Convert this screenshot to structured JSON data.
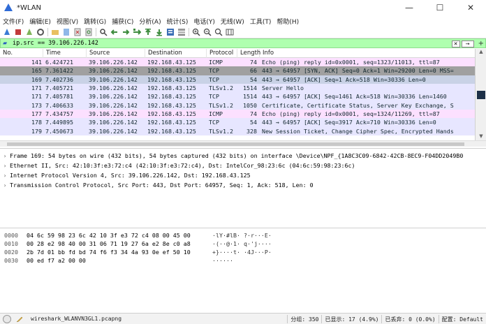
{
  "window": {
    "title": "*WLAN",
    "minimize_glyph": "—",
    "maximize_glyph": "☐",
    "close_glyph": "✕"
  },
  "menu": [
    "文件(F)",
    "编辑(E)",
    "视图(V)",
    "跳转(G)",
    "捕获(C)",
    "分析(A)",
    "统计(S)",
    "电话(Y)",
    "无线(W)",
    "工具(T)",
    "帮助(H)"
  ],
  "toolbar_icons": [
    "shark-fin-start-icon",
    "stop-capture-icon",
    "restart-capture-icon",
    "capture-options-icon",
    "open-file-icon",
    "save-file-icon",
    "close-file-icon",
    "reload-file-icon",
    "find-packet-icon",
    "go-back-icon",
    "go-forward-icon",
    "go-to-packet-icon",
    "go-first-icon",
    "go-last-icon",
    "autoscroll-icon",
    "colorize-icon",
    "zoom-in-icon",
    "zoom-out-icon",
    "zoom-normal-icon",
    "resize-columns-icon"
  ],
  "filter": {
    "text": "ip.src == 39.106.226.142",
    "clear_glyph": "✕",
    "apply_glyph": "→",
    "add_glyph": "+"
  },
  "packet_list": {
    "columns": [
      "No.",
      "Time",
      "Source",
      "Destination",
      "Protocol",
      "Length",
      "Info"
    ],
    "rows": [
      {
        "no": "141",
        "time": "6.424721",
        "src": "39.106.226.142",
        "dst": "192.168.43.125",
        "proto": "ICMP",
        "len": "74",
        "info": "Echo (ping) reply    id=0x0001, seq=1323/11013, ttl=87",
        "bg": "#fce0ff",
        "fg": "#12272e"
      },
      {
        "no": "165",
        "time": "7.361422",
        "src": "39.106.226.142",
        "dst": "192.168.43.125",
        "proto": "TCP",
        "len": "66",
        "info": "443 → 64957 [SYN, ACK] Seq=0 Ack=1 Win=29200 Len=0 MSS=",
        "bg": "#a0a0a0",
        "fg": "#12272e"
      },
      {
        "no": "169",
        "time": "7.402736",
        "src": "39.106.226.142",
        "dst": "192.168.43.125",
        "proto": "TCP",
        "len": "54",
        "info": "443 → 64957 [ACK] Seq=1 Ack=518 Win=30336 Len=0",
        "bg": "#c9d2e6",
        "fg": "#12272e"
      },
      {
        "no": "171",
        "time": "7.405721",
        "src": "39.106.226.142",
        "dst": "192.168.43.125",
        "proto": "TLSv1.2",
        "len": "1514",
        "info": "Server Hello",
        "bg": "#e7e6ff",
        "fg": "#12272e"
      },
      {
        "no": "171",
        "time": "7.405781",
        "src": "39.106.226.142",
        "dst": "192.168.43.125",
        "proto": "TCP",
        "len": "1514",
        "info": "443 → 64957 [ACK] Seq=1461 Ack=518 Win=30336 Len=1460",
        "bg": "#e7e6ff",
        "fg": "#12272e"
      },
      {
        "no": "173",
        "time": "7.406633",
        "src": "39.106.226.142",
        "dst": "192.168.43.125",
        "proto": "TLSv1.2",
        "len": "1050",
        "info": "Certificate, Certificate Status, Server Key Exchange, S",
        "bg": "#e7e6ff",
        "fg": "#12272e"
      },
      {
        "no": "177",
        "time": "7.434757",
        "src": "39.106.226.142",
        "dst": "192.168.43.125",
        "proto": "ICMP",
        "len": "74",
        "info": "Echo (ping) reply    id=0x0001, seq=1324/11269, ttl=87",
        "bg": "#fce0ff",
        "fg": "#12272e"
      },
      {
        "no": "178",
        "time": "7.449895",
        "src": "39.106.226.142",
        "dst": "192.168.43.125",
        "proto": "TCP",
        "len": "54",
        "info": "443 → 64957 [ACK] Seq=3917 Ack=710 Win=30336 Len=0",
        "bg": "#e7e6ff",
        "fg": "#12272e"
      },
      {
        "no": "179",
        "time": "7.450673",
        "src": "39.106.226.142",
        "dst": "192.168.43.125",
        "proto": "TLSv1.2",
        "len": "328",
        "info": "New Session Ticket, Change Cipher Spec, Encrypted Hands",
        "bg": "#e7e6ff",
        "fg": "#12272e"
      }
    ]
  },
  "details": [
    "Frame 169: 54 bytes on wire (432 bits), 54 bytes captured (432 bits) on interface \\Device\\NPF_{1A8C3C09-6842-42CB-8EC9-F04DD2049B0",
    "Ethernet II, Src: 42:10:3f:e3:72:c4 (42:10:3f:e3:72:c4), Dst: IntelCor_98:23:6c (04:6c:59:98:23:6c)",
    "Internet Protocol Version 4, Src: 39.106.226.142, Dst: 192.168.43.125",
    "Transmission Control Protocol, Src Port: 443, Dst Port: 64957, Seq: 1, Ack: 518, Len: 0"
  ],
  "details_arrow": "›",
  "bytes": [
    {
      "off": "0000",
      "hex": "04 6c 59 98 23 6c 42 10  3f e3 72 c4 08 00 45 00",
      "ascii": "·lY·#lB· ?·r···E·"
    },
    {
      "off": "0010",
      "hex": "00 28 e2 98 40 00 31 06  71 19 27 6a e2 8e c0 a8",
      "ascii": "·(··@·1· q·'j····"
    },
    {
      "off": "0020",
      "hex": "2b 7d 01 bb fd bd 74 f6  f3 34 4a 93 0e ef 50 10",
      "ascii": "+}····t· ·4J···P·"
    },
    {
      "off": "0030",
      "hex": "00 ed f7 a2 00 00",
      "ascii": "······"
    }
  ],
  "status": {
    "file": "wireshark_WLANVN3GL1.pcapng",
    "packets": "分组: 350",
    "displayed": "已显示: 17 (4.9%)",
    "dropped": "已丢弃: 0 (0.0%)",
    "profile": "配置: Default"
  },
  "colors": {
    "filter_bg": "#afffaf",
    "selected_row": "#a0a0a0",
    "scroll_thumb": "#1c2f47"
  }
}
